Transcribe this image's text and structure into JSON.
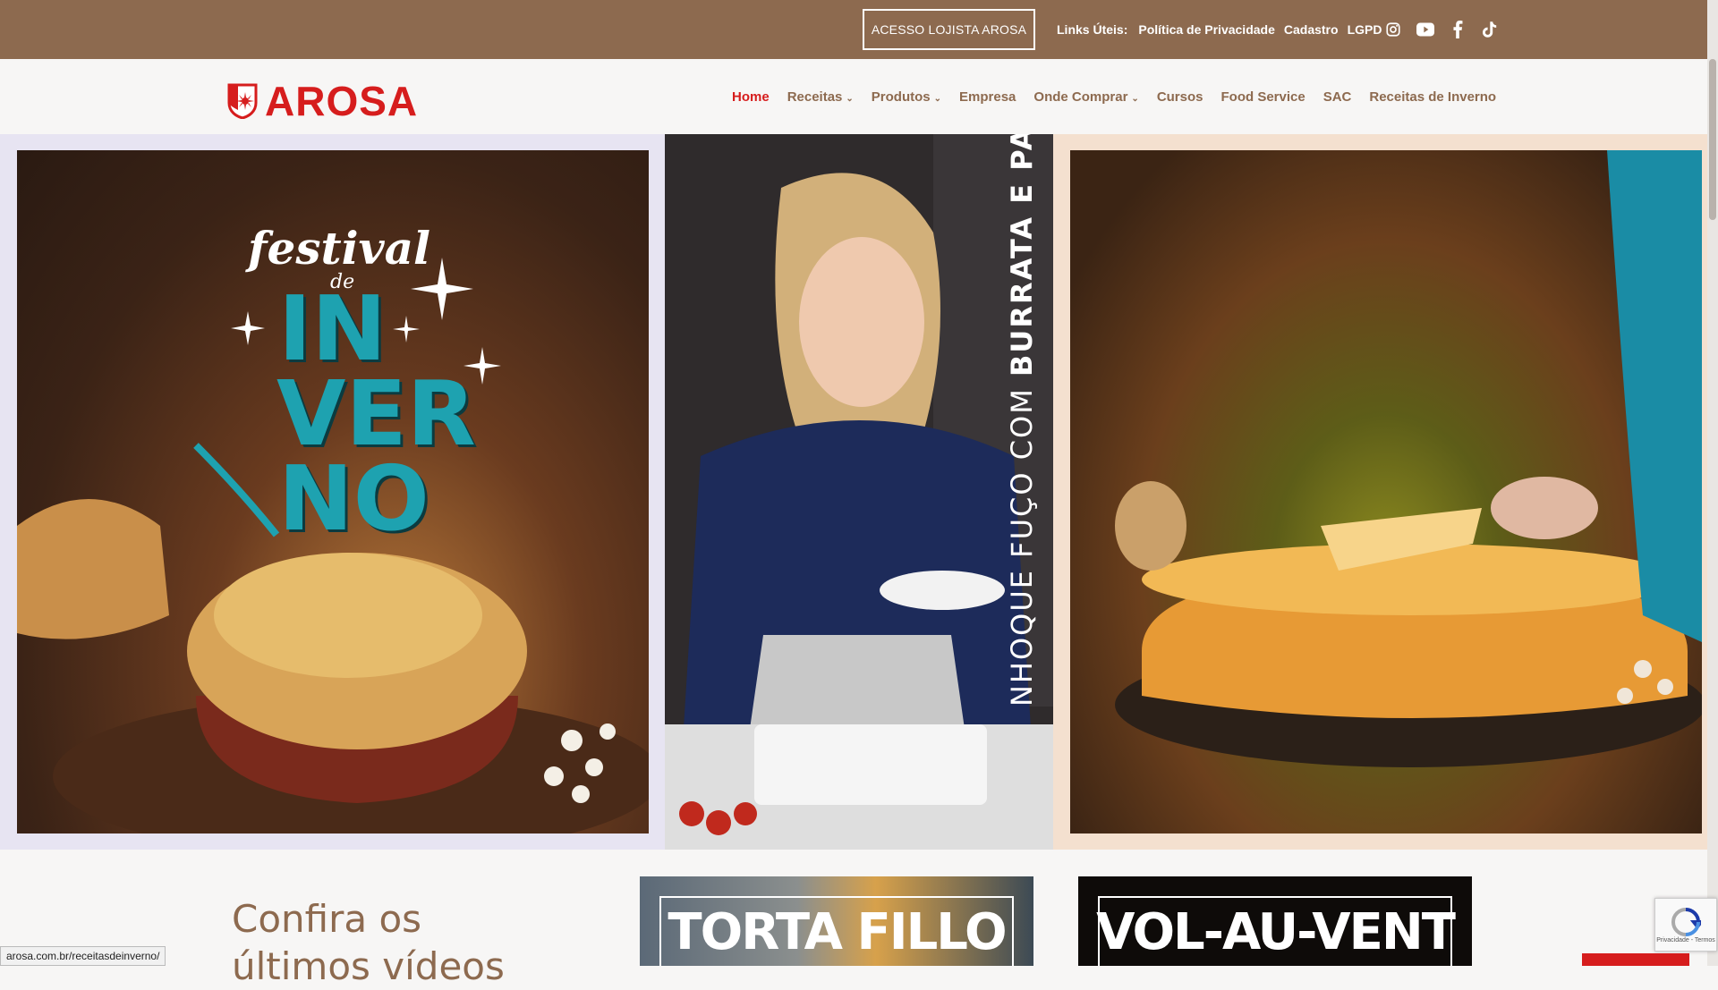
{
  "topbar": {
    "lojista_button": "ACESSO LOJISTA AROSA",
    "links_label": "Links Úteis:",
    "links": [
      "Política de Privacidade",
      "Cadastro",
      "LGPD"
    ],
    "social_icons": [
      "instagram-icon",
      "youtube-icon",
      "facebook-icon",
      "tiktok-icon"
    ]
  },
  "header": {
    "logo_text": "AROSA",
    "nav": [
      {
        "label": "Home",
        "active": true
      },
      {
        "label": "Receitas",
        "dropdown": true
      },
      {
        "label": "Produtos",
        "dropdown": true
      },
      {
        "label": "Empresa"
      },
      {
        "label": "Onde Comprar",
        "dropdown": true
      },
      {
        "label": "Cursos"
      },
      {
        "label": "Food Service"
      },
      {
        "label": "SAC"
      },
      {
        "label": "Receitas de Inverno"
      }
    ],
    "caret": "⌄"
  },
  "banner": {
    "left": {
      "script": "festival",
      "de": "de",
      "lines": [
        "IN",
        "VER",
        "NO"
      ]
    },
    "middle": {
      "text_light": "NHOQUE FUÇO COM ",
      "text_bold": "BURRATA E PARMA"
    }
  },
  "videos": {
    "title_line1": "Confira os",
    "title_line2": "últimos vídeos"
  },
  "cards": [
    "TORTA FILLO",
    "VOL-AU-VENT"
  ],
  "status_url": "arosa.com.br/receitasdeinverno/",
  "recaptcha_text": "Privacidade - Termos",
  "colors": {
    "brown": "#8d6a4f",
    "red": "#d61d1d",
    "teal": "#1ea2b0"
  }
}
